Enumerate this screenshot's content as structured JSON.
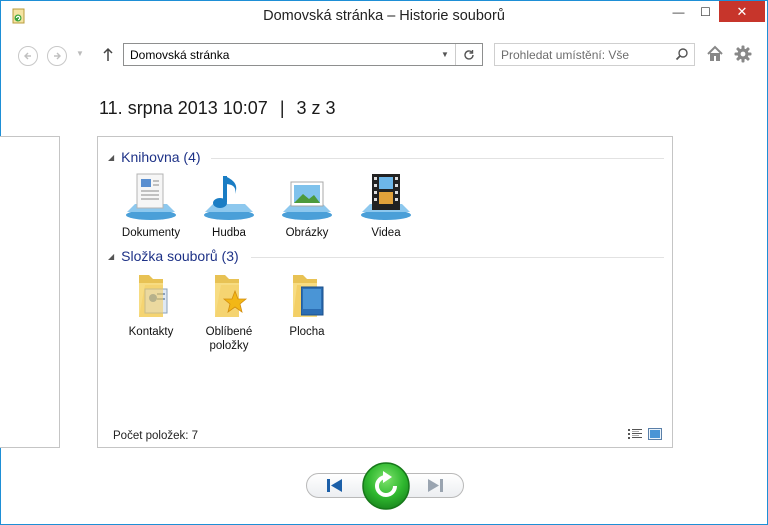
{
  "window": {
    "title": "Domovská stránka – Historie souborů",
    "min_glyph": "—",
    "max_glyph": "☐",
    "close_glyph": "✕"
  },
  "nav": {
    "address": "Domovská stránka",
    "search_placeholder": "Prohledat umístění: Vše"
  },
  "snapshot": {
    "date": "11. srpna 2013 10:07",
    "separator": "|",
    "position": "3 z 3"
  },
  "groups": [
    {
      "heading": "Knihovna (4)",
      "items": [
        {
          "label": "Dokumenty",
          "icon": "documents-library-icon"
        },
        {
          "label": "Hudba",
          "icon": "music-library-icon"
        },
        {
          "label": "Obrázky",
          "icon": "pictures-library-icon"
        },
        {
          "label": "Videa",
          "icon": "videos-library-icon"
        }
      ]
    },
    {
      "heading": "Složka souborů (3)",
      "items": [
        {
          "label": "Kontakty",
          "icon": "contacts-folder-icon"
        },
        {
          "label": "Oblíbené položky",
          "icon": "favorites-folder-icon"
        },
        {
          "label": "Plocha",
          "icon": "desktop-folder-icon"
        }
      ]
    }
  ],
  "status": {
    "item_count": "Počet položek: 7"
  },
  "colors": {
    "accent": "#1e8fd6",
    "close": "#c7352b",
    "group_heading": "#1e3287",
    "restore_green": "#2fb82f",
    "nav_arrows": "#1c5fa8"
  }
}
